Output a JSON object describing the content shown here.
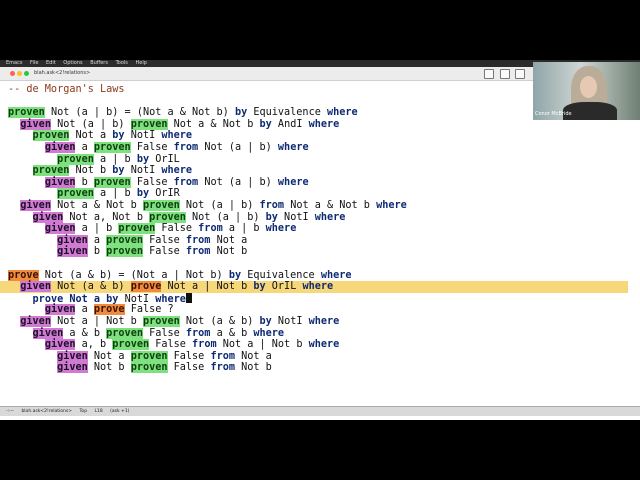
{
  "menubar": {
    "items": [
      "Emacs",
      "File",
      "Edit",
      "Options",
      "Buffers",
      "Tools",
      "Help"
    ]
  },
  "window": {
    "tab_title": "blah.ask<2!relations>"
  },
  "webcam": {
    "name": "Conor McBride"
  },
  "modeline": {
    "items": [
      "-:---",
      "blah.ask<2!relations>",
      "Top",
      "L18",
      "(ask +1)"
    ]
  },
  "colors": {
    "given": "#d07ad2",
    "proven": "#7ee07e",
    "prove": "#f08a3d",
    "highlight": "#f6d87a"
  },
  "editor": {
    "lines": [
      [
        {
          "t": "-- de Morgan's Laws",
          "c": "cmt"
        }
      ],
      [],
      [
        {
          "t": "proven",
          "c": "proven"
        },
        {
          "t": " Not (a | b) = (Not a & Not b) "
        },
        {
          "t": "by",
          "c": "kw"
        },
        {
          "t": " Equivalence "
        },
        {
          "t": "where",
          "c": "kw"
        }
      ],
      [
        {
          "t": "  "
        },
        {
          "t": "given",
          "c": "given"
        },
        {
          "t": " Not (a | b) "
        },
        {
          "t": "proven",
          "c": "proven"
        },
        {
          "t": " Not a & Not b "
        },
        {
          "t": "by",
          "c": "kw"
        },
        {
          "t": " AndI "
        },
        {
          "t": "where",
          "c": "kw"
        }
      ],
      [
        {
          "t": "    "
        },
        {
          "t": "proven",
          "c": "proven"
        },
        {
          "t": " Not a "
        },
        {
          "t": "by",
          "c": "kw"
        },
        {
          "t": " NotI "
        },
        {
          "t": "where",
          "c": "kw"
        }
      ],
      [
        {
          "t": "      "
        },
        {
          "t": "given",
          "c": "given"
        },
        {
          "t": " a "
        },
        {
          "t": "proven",
          "c": "proven"
        },
        {
          "t": " False "
        },
        {
          "t": "from",
          "c": "kw"
        },
        {
          "t": " Not (a | b) "
        },
        {
          "t": "where",
          "c": "kw"
        }
      ],
      [
        {
          "t": "        "
        },
        {
          "t": "proven",
          "c": "proven"
        },
        {
          "t": " a | b "
        },
        {
          "t": "by",
          "c": "kw"
        },
        {
          "t": " OrIL"
        }
      ],
      [
        {
          "t": "    "
        },
        {
          "t": "proven",
          "c": "proven"
        },
        {
          "t": " Not b "
        },
        {
          "t": "by",
          "c": "kw"
        },
        {
          "t": " NotI "
        },
        {
          "t": "where",
          "c": "kw"
        }
      ],
      [
        {
          "t": "      "
        },
        {
          "t": "given",
          "c": "given"
        },
        {
          "t": " b "
        },
        {
          "t": "proven",
          "c": "proven"
        },
        {
          "t": " False "
        },
        {
          "t": "from",
          "c": "kw"
        },
        {
          "t": " Not (a | b) "
        },
        {
          "t": "where",
          "c": "kw"
        }
      ],
      [
        {
          "t": "        "
        },
        {
          "t": "proven",
          "c": "proven"
        },
        {
          "t": " a | b "
        },
        {
          "t": "by",
          "c": "kw"
        },
        {
          "t": " OrIR"
        }
      ],
      [
        {
          "t": "  "
        },
        {
          "t": "given",
          "c": "given"
        },
        {
          "t": " Not a & Not b "
        },
        {
          "t": "proven",
          "c": "proven"
        },
        {
          "t": " Not (a | b) "
        },
        {
          "t": "from",
          "c": "kw"
        },
        {
          "t": " Not a & Not b "
        },
        {
          "t": "where",
          "c": "kw"
        }
      ],
      [
        {
          "t": "    "
        },
        {
          "t": "given",
          "c": "given"
        },
        {
          "t": " Not a, Not b "
        },
        {
          "t": "proven",
          "c": "proven"
        },
        {
          "t": " Not (a | b) "
        },
        {
          "t": "by",
          "c": "kw"
        },
        {
          "t": " NotI "
        },
        {
          "t": "where",
          "c": "kw"
        }
      ],
      [
        {
          "t": "      "
        },
        {
          "t": "given",
          "c": "given"
        },
        {
          "t": " a | b "
        },
        {
          "t": "proven",
          "c": "proven"
        },
        {
          "t": " False "
        },
        {
          "t": "from",
          "c": "kw"
        },
        {
          "t": " a | b "
        },
        {
          "t": "where",
          "c": "kw"
        }
      ],
      [
        {
          "t": "        "
        },
        {
          "t": "given",
          "c": "given"
        },
        {
          "t": " a "
        },
        {
          "t": "proven",
          "c": "proven"
        },
        {
          "t": " False "
        },
        {
          "t": "from",
          "c": "kw"
        },
        {
          "t": " Not a"
        }
      ],
      [
        {
          "t": "        "
        },
        {
          "t": "given",
          "c": "given"
        },
        {
          "t": " b "
        },
        {
          "t": "proven",
          "c": "proven"
        },
        {
          "t": " False "
        },
        {
          "t": "from",
          "c": "kw"
        },
        {
          "t": " Not b"
        }
      ],
      [],
      [
        {
          "t": "prove",
          "c": "prove"
        },
        {
          "t": " Not (a & b) = (Not a | Not b) "
        },
        {
          "t": "by",
          "c": "kw"
        },
        {
          "t": " Equivalence "
        },
        {
          "t": "where",
          "c": "kw"
        }
      ],
      [
        {
          "t": "  "
        },
        {
          "t": "given",
          "c": "given"
        },
        {
          "t": " Not (a & b) "
        },
        {
          "t": "prove",
          "c": "prove"
        },
        {
          "t": " Not a | Not b "
        },
        {
          "t": "by",
          "c": "kw"
        },
        {
          "t": " OrIL "
        },
        {
          "t": "where",
          "c": "kw"
        }
      ],
      [
        {
          "t": "    "
        },
        {
          "t": "prove Not a ",
          "c": "kw"
        },
        {
          "t": "by",
          "c": "kw"
        },
        {
          "t": " NotI "
        },
        {
          "t": "where",
          "c": "kw"
        },
        {
          "cursor": true
        }
      ],
      [
        {
          "t": "      "
        },
        {
          "t": "given",
          "c": "given"
        },
        {
          "t": " a "
        },
        {
          "t": "prove",
          "c": "prove"
        },
        {
          "t": " False ?"
        }
      ],
      [
        {
          "t": "  "
        },
        {
          "t": "given",
          "c": "given"
        },
        {
          "t": " Not a | Not b "
        },
        {
          "t": "proven",
          "c": "proven"
        },
        {
          "t": " Not (a & b) "
        },
        {
          "t": "by",
          "c": "kw"
        },
        {
          "t": " NotI "
        },
        {
          "t": "where",
          "c": "kw"
        }
      ],
      [
        {
          "t": "    "
        },
        {
          "t": "given",
          "c": "given"
        },
        {
          "t": " a & b "
        },
        {
          "t": "proven",
          "c": "proven"
        },
        {
          "t": " False "
        },
        {
          "t": "from",
          "c": "kw"
        },
        {
          "t": " a & b "
        },
        {
          "t": "where",
          "c": "kw"
        }
      ],
      [
        {
          "t": "      "
        },
        {
          "t": "given",
          "c": "given"
        },
        {
          "t": " a, b "
        },
        {
          "t": "proven",
          "c": "proven"
        },
        {
          "t": " False "
        },
        {
          "t": "from",
          "c": "kw"
        },
        {
          "t": " Not a | Not b "
        },
        {
          "t": "where",
          "c": "kw"
        }
      ],
      [
        {
          "t": "        "
        },
        {
          "t": "given",
          "c": "given"
        },
        {
          "t": " Not a "
        },
        {
          "t": "proven",
          "c": "proven"
        },
        {
          "t": " False "
        },
        {
          "t": "from",
          "c": "kw"
        },
        {
          "t": " Not a"
        }
      ],
      [
        {
          "t": "        "
        },
        {
          "t": "given",
          "c": "given"
        },
        {
          "t": " Not b "
        },
        {
          "t": "proven",
          "c": "proven"
        },
        {
          "t": " False "
        },
        {
          "t": "from",
          "c": "kw"
        },
        {
          "t": " Not b"
        }
      ]
    ]
  }
}
